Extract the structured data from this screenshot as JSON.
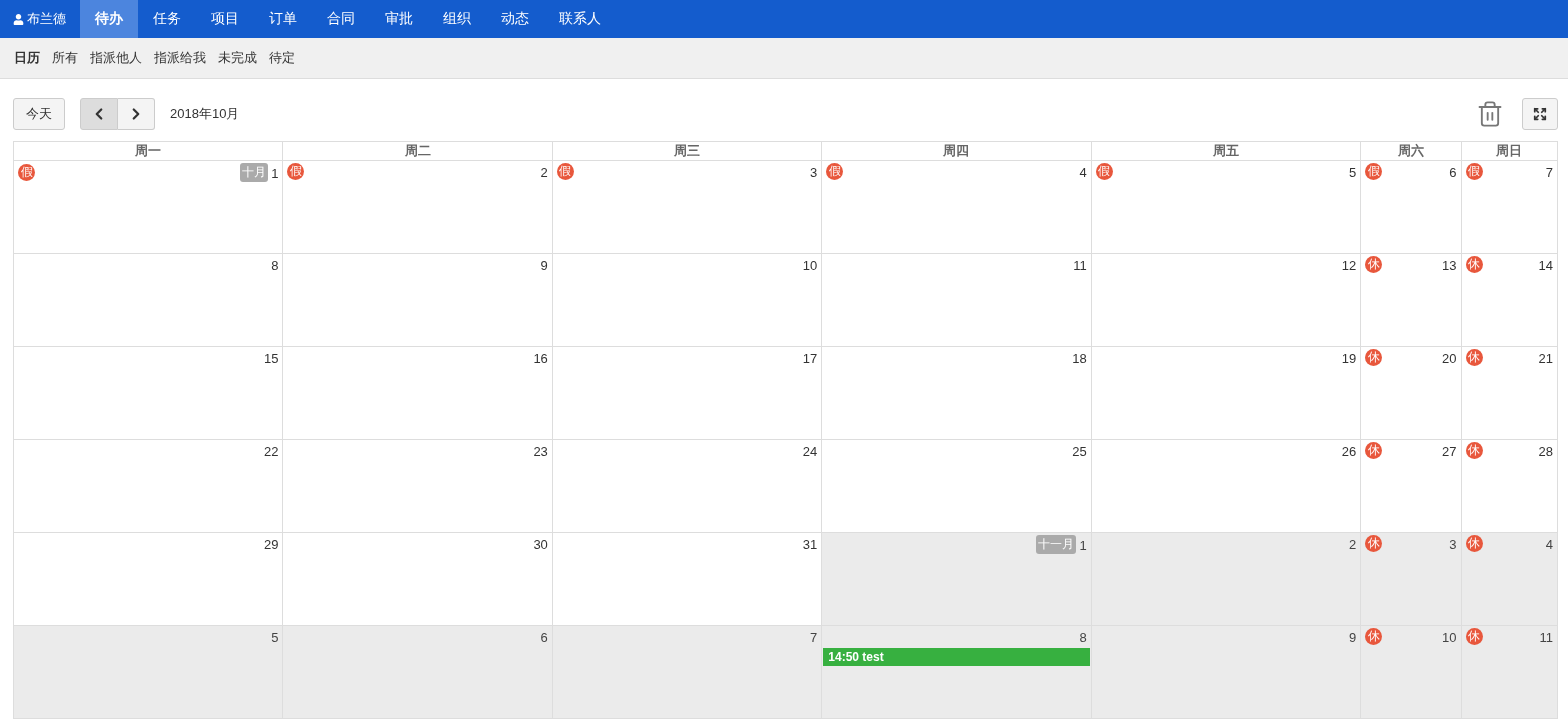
{
  "nav": {
    "user": "布兰德",
    "items": [
      {
        "label": "待办",
        "selected": true
      },
      {
        "label": "任务",
        "selected": false
      },
      {
        "label": "项目",
        "selected": false
      },
      {
        "label": "订单",
        "selected": false
      },
      {
        "label": "合同",
        "selected": false
      },
      {
        "label": "审批",
        "selected": false
      },
      {
        "label": "组织",
        "selected": false
      },
      {
        "label": "动态",
        "selected": false
      },
      {
        "label": "联系人",
        "selected": false
      }
    ]
  },
  "subnav": [
    {
      "label": "日历",
      "selected": true
    },
    {
      "label": "所有",
      "selected": false
    },
    {
      "label": "指派他人",
      "selected": false
    },
    {
      "label": "指派给我",
      "selected": false
    },
    {
      "label": "未完成",
      "selected": false
    },
    {
      "label": "待定",
      "selected": false
    }
  ],
  "toolbar": {
    "today": "今天",
    "title": "2018年10月"
  },
  "calendar": {
    "weekdays": [
      "周一",
      "周二",
      "周三",
      "周四",
      "周五",
      "周六",
      "周日"
    ],
    "weeks": [
      [
        {
          "day": "1",
          "other_month": false,
          "mark": "假",
          "month_label": "十月"
        },
        {
          "day": "2",
          "other_month": false,
          "mark": "假"
        },
        {
          "day": "3",
          "other_month": false,
          "mark": "假"
        },
        {
          "day": "4",
          "other_month": false,
          "mark": "假"
        },
        {
          "day": "5",
          "other_month": false,
          "mark": "假"
        },
        {
          "day": "6",
          "other_month": false,
          "mark": "假"
        },
        {
          "day": "7",
          "other_month": false,
          "mark": "假"
        }
      ],
      [
        {
          "day": "8",
          "other_month": false
        },
        {
          "day": "9",
          "other_month": false
        },
        {
          "day": "10",
          "other_month": false
        },
        {
          "day": "11",
          "other_month": false
        },
        {
          "day": "12",
          "other_month": false
        },
        {
          "day": "13",
          "other_month": false,
          "mark": "休"
        },
        {
          "day": "14",
          "other_month": false,
          "mark": "休"
        }
      ],
      [
        {
          "day": "15",
          "other_month": false
        },
        {
          "day": "16",
          "other_month": false
        },
        {
          "day": "17",
          "other_month": false
        },
        {
          "day": "18",
          "other_month": false
        },
        {
          "day": "19",
          "other_month": false
        },
        {
          "day": "20",
          "other_month": false,
          "mark": "休"
        },
        {
          "day": "21",
          "other_month": false,
          "mark": "休"
        }
      ],
      [
        {
          "day": "22",
          "other_month": false
        },
        {
          "day": "23",
          "other_month": false
        },
        {
          "day": "24",
          "other_month": false
        },
        {
          "day": "25",
          "other_month": false
        },
        {
          "day": "26",
          "other_month": false
        },
        {
          "day": "27",
          "other_month": false,
          "mark": "休"
        },
        {
          "day": "28",
          "other_month": false,
          "mark": "休"
        }
      ],
      [
        {
          "day": "29",
          "other_month": false
        },
        {
          "day": "30",
          "other_month": false
        },
        {
          "day": "31",
          "other_month": false
        },
        {
          "day": "1",
          "other_month": true,
          "month_label": "十一月"
        },
        {
          "day": "2",
          "other_month": true
        },
        {
          "day": "3",
          "other_month": true,
          "mark": "休"
        },
        {
          "day": "4",
          "other_month": true,
          "mark": "休"
        }
      ],
      [
        {
          "day": "5",
          "other_month": true
        },
        {
          "day": "6",
          "other_month": true
        },
        {
          "day": "7",
          "other_month": true
        },
        {
          "day": "8",
          "other_month": true,
          "events": [
            "14:50 test"
          ]
        },
        {
          "day": "9",
          "other_month": true
        },
        {
          "day": "10",
          "other_month": true,
          "mark": "休"
        },
        {
          "day": "11",
          "other_month": true,
          "mark": "休"
        }
      ]
    ]
  }
}
